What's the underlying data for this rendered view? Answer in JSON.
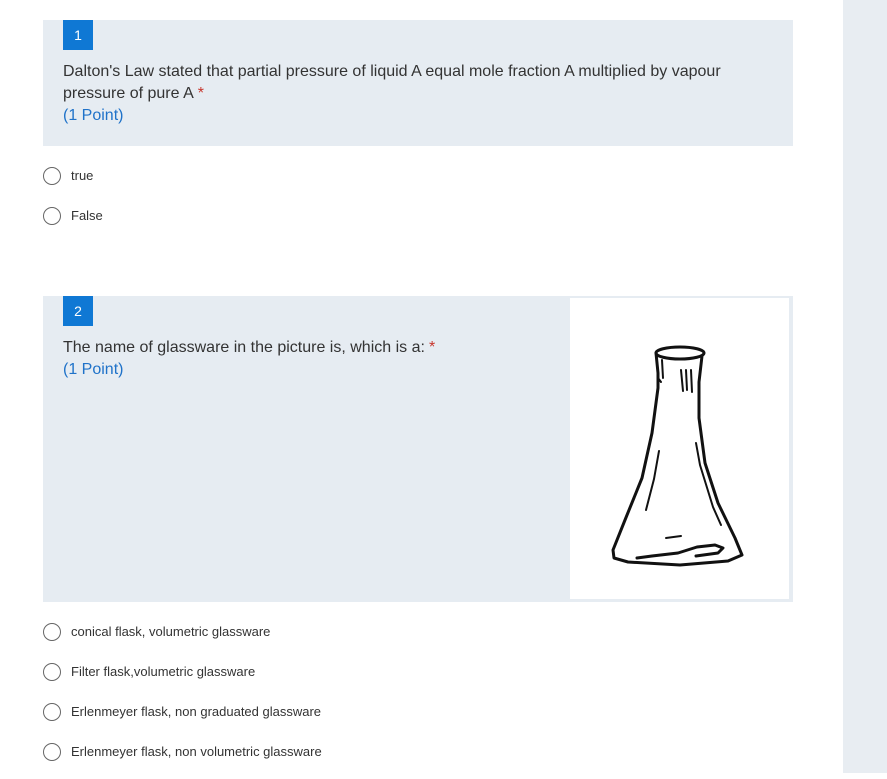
{
  "colors": {
    "accent_blue": "#0f78d4",
    "question_background": "#e6ecf2",
    "required_red": "#c7352c",
    "points_blue": "#1f72c9"
  },
  "questions": [
    {
      "number": "1",
      "text": "Dalton's Law stated that partial pressure of liquid A equal mole fraction A multiplied by vapour pressure of pure A",
      "required_marker": "*",
      "points": "(1 Point)",
      "options": [
        {
          "label": "true",
          "selected": false
        },
        {
          "label": "False",
          "selected": false
        }
      ]
    },
    {
      "number": "2",
      "text": "The name of glassware in the picture is, which is a:",
      "required_marker": "*",
      "points": "(1 Point)",
      "image_icon": "erlenmeyer-flask-drawing",
      "options": [
        {
          "label": "conical flask, volumetric glassware",
          "selected": false
        },
        {
          "label": "Filter flask,volumetric glassware",
          "selected": false
        },
        {
          "label": "Erlenmeyer flask, non graduated glassware",
          "selected": false
        },
        {
          "label": "Erlenmeyer flask, non volumetric glassware",
          "selected": false
        }
      ]
    }
  ]
}
